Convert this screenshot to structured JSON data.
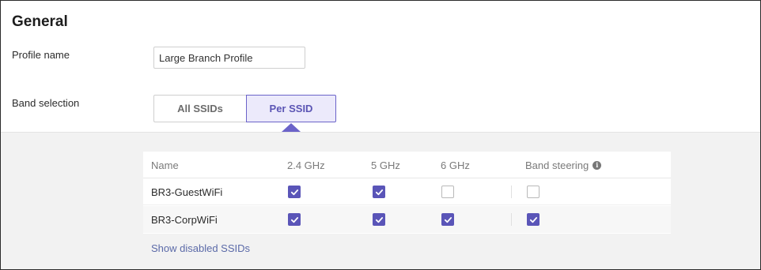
{
  "general": {
    "title": "General",
    "profile_label": "Profile name",
    "profile_value": "Large Branch Profile",
    "band_label": "Band selection",
    "band_options": [
      "All SSIDs",
      "Per SSID"
    ],
    "band_selected": "Per SSID"
  },
  "table": {
    "headers": [
      "Name",
      "2.4 GHz",
      "5 GHz",
      "6 GHz",
      "Band steering"
    ],
    "rows": [
      {
        "name": "BR3-GuestWiFi",
        "ghz24": true,
        "ghz5": true,
        "ghz6": false,
        "band_steering": false
      },
      {
        "name": "BR3-CorpWiFi",
        "ghz24": true,
        "ghz5": true,
        "ghz6": true,
        "band_steering": true
      }
    ]
  },
  "show_disabled_label": "Show disabled SSIDs",
  "colors": {
    "accent": "#5a55b8",
    "accent_bg": "#eceafb",
    "link": "#5b6aa8",
    "panel_bg": "#f2f2f2"
  },
  "icons": {
    "info": "info-circle-icon",
    "check": "check-icon"
  }
}
